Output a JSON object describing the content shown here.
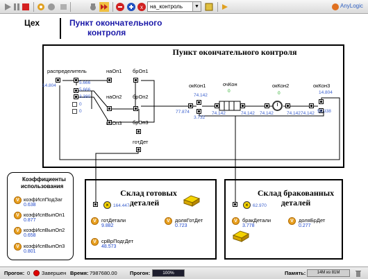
{
  "toolbar": {
    "experiment_select": "на_контроль",
    "brand": "AnyLogic",
    "buttons": [
      "run-icon",
      "pause-icon",
      "stop-icon",
      "step-icon",
      "settings-icon",
      "copy-icon",
      "camera-icon",
      "fast-forward-icon",
      "speed-down-icon",
      "speed-up-icon",
      "virtual-time-icon",
      "dropdown-icon",
      "navigate-icon"
    ]
  },
  "header": {
    "shop": "Цех",
    "title_line1": "Пункт окончательного",
    "title_line2": "контроля"
  },
  "main_box": {
    "title": "Пункт окончательного контроля",
    "labels": {
      "distributor": "распределитель",
      "naOp1": "наОп1",
      "brOp1": "брОп1",
      "naOp2": "наОп2",
      "brOp2": "брОп2",
      "naOp3": "наОп3",
      "brOp3": "брОп3",
      "gotDet": "готДет",
      "okKon1": "окКон1",
      "ochKon": "очКон",
      "okKon2": "окКон2",
      "okKon3": "окКон3"
    },
    "values": {
      "dist_in": "14.804",
      "out1": "5.666",
      "out2": "5.666",
      "out3": "3.380",
      "zero_a": "0",
      "zero_b": "0",
      "okKon1_top": "74.142",
      "okKon1_left": "77.874",
      "okKon1_bottom": "3.732",
      "queue_left": "74.142",
      "queue_right": "74.142",
      "queue_zero": "0",
      "okKon2_left": "74.142",
      "okKon2_zero": "0",
      "okKon2_right": "74.142",
      "okKon3_top": "14.804",
      "okKon3_bottom": "59.338",
      "okKon3_left": "74.142"
    }
  },
  "coef_box": {
    "title_line1": "Коэффициенты",
    "title_line2": "использования",
    "items": [
      {
        "name": "коэфИспПодЗаг",
        "value": "0.638"
      },
      {
        "name": "коэфИспВыпОп1",
        "value": "0.877"
      },
      {
        "name": "коэфИспВыпОп2",
        "value": "0.658"
      },
      {
        "name": "коэфИспВыпОп3",
        "value": "0.801"
      }
    ]
  },
  "good_box": {
    "title_line1": "Склад готовых",
    "title_line2": "деталей",
    "sink_value": "164.447",
    "vars": [
      {
        "name": "готДетали",
        "value": "9.882"
      },
      {
        "name": "доляГотДет",
        "value": "0.723"
      },
      {
        "name": "срВрПодгДет",
        "value": "48.573"
      }
    ]
  },
  "reject_box": {
    "title_line1": "Склад бракованных",
    "title_line2": "деталей",
    "sink_value": "62.970",
    "vars": [
      {
        "name": "бракДетали",
        "value": "3.778"
      },
      {
        "name": "доляБрДет",
        "value": "0.277"
      }
    ]
  },
  "statusbar": {
    "progress_label": "Прогон:",
    "run_number": "0",
    "state": "Завершен",
    "time_label": "Время:",
    "time_value": "7987680.00",
    "progress2_label": "Прогон:",
    "progress_text": "100%",
    "progress_value": 1.0,
    "memory_label": "Память:",
    "memory_value": "14M из 81M"
  },
  "colors": {
    "accent": "#1a18a8",
    "value_blue": "#3a5fcd",
    "variable_orange": "#e8a020"
  }
}
